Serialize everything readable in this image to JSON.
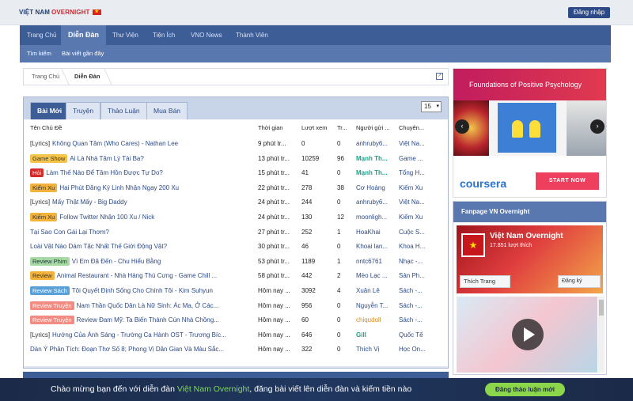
{
  "logo": {
    "part1": "VIỆT NAM",
    "part2": "OVERNIGHT"
  },
  "header": {
    "login_label": "Đăng nhập"
  },
  "nav": [
    {
      "label": "Trang Chủ"
    },
    {
      "label": "Diễn Đàn"
    },
    {
      "label": "Thư Viện"
    },
    {
      "label": "Tiện Ích"
    },
    {
      "label": "VNO News"
    },
    {
      "label": "Thành Viên"
    }
  ],
  "subnav": [
    {
      "label": "Tìm kiếm"
    },
    {
      "label": "Bài viết gần đây"
    }
  ],
  "breadcrumb": [
    {
      "label": "Trang Chủ"
    },
    {
      "label": "Diễn Đàn"
    }
  ],
  "tabs": [
    {
      "label": "Bài Mới"
    },
    {
      "label": "Truyện"
    },
    {
      "label": "Thảo Luận"
    },
    {
      "label": "Mua Bán"
    }
  ],
  "per_page": "15",
  "table": {
    "headers": {
      "title": "Tên Chủ Đề",
      "time": "Thời gian",
      "views": "Lượt xem",
      "replies": "Tr...",
      "poster": "Người gửi ...",
      "forum": "Chuyên..."
    },
    "rows": [
      {
        "prefix": "[Lyrics]",
        "prefix_style": "lyrics",
        "title": "Không Quan Tâm (Who Cares) - Nathan Lee",
        "time": "9 phút tr...",
        "views": "0",
        "replies": "0",
        "poster": "anhruby6...",
        "poster_style": "plain",
        "forum": "Việt Na..."
      },
      {
        "prefix": "Game Show",
        "prefix_style": "game",
        "title": "Ai Là Nhà Tâm Lý Tài Ba?",
        "time": "13 phút tr...",
        "views": "10259",
        "replies": "96",
        "poster": "Mạnh Th...",
        "poster_style": "green",
        "forum": "Game ..."
      },
      {
        "prefix": "Hỏi",
        "prefix_style": "hoi",
        "title": "Làm Thế Nào Để Tâm Hồn Được Tự Do?",
        "time": "15 phút tr...",
        "views": "41",
        "replies": "0",
        "poster": "Mạnh Th...",
        "poster_style": "green",
        "forum": "Tổng H..."
      },
      {
        "prefix": "Kiếm Xu",
        "prefix_style": "kiem",
        "title": "Hai Phút Đăng Ký Linh Nhận Ngay 200 Xu",
        "time": "22 phút tr...",
        "views": "278",
        "replies": "38",
        "poster": "Cơ Hoàng",
        "poster_style": "plain",
        "forum": "Kiếm Xu"
      },
      {
        "prefix": "[Lyrics]",
        "prefix_style": "lyrics",
        "title": "Mấy Thật Mấy - Big Daddy",
        "time": "24 phút tr...",
        "views": "244",
        "replies": "0",
        "poster": "anhruby6...",
        "poster_style": "plain",
        "forum": "Việt Na..."
      },
      {
        "prefix": "Kiếm Xu",
        "prefix_style": "kiem",
        "title": "Follow Twitter Nhận 100 Xu / Nick",
        "time": "24 phút tr...",
        "views": "130",
        "replies": "12",
        "poster": "moonligh...",
        "poster_style": "plain",
        "forum": "Kiếm Xu"
      },
      {
        "prefix": "",
        "prefix_style": "none",
        "title": "Tại Sao Con Gái Lại Thơm?",
        "time": "27 phút tr...",
        "views": "252",
        "replies": "1",
        "poster": "HoaKhai",
        "poster_style": "plain",
        "forum": "Cuộc S..."
      },
      {
        "prefix": "",
        "prefix_style": "none",
        "title": "Loài Vật Nào Dám Tặc Nhất Thế Giới Động Vật?",
        "time": "30 phút tr...",
        "views": "46",
        "replies": "0",
        "poster": "Khoai lan...",
        "poster_style": "plain",
        "forum": "Khoa H..."
      },
      {
        "prefix": "Review Phim",
        "prefix_style": "phim",
        "title": "Vì Em Đã Đến - Chu Hiểu Bằng",
        "time": "53 phút tr...",
        "views": "1189",
        "replies": "1",
        "poster": "nntc6761",
        "poster_style": "plain",
        "forum": "Nhạc -..."
      },
      {
        "prefix": "Review",
        "prefix_style": "review",
        "title": "Animal Restaurant - Nhà Hàng Thú Cưng - Game Chill ...",
        "time": "58 phút tr...",
        "views": "442",
        "replies": "2",
        "poster": "Mèo Lạc ...",
        "poster_style": "plain",
        "forum": "Sản Ph..."
      },
      {
        "prefix": "Review Sách",
        "prefix_style": "sach",
        "title": "Tôi Quyết Định Sống Cho Chính Tôi - Kim Suhyun",
        "time": "Hôm nay ...",
        "views": "3092",
        "replies": "4",
        "poster": "Xuân Lê",
        "poster_style": "plain",
        "forum": "Sách -..."
      },
      {
        "prefix": "Review Truyện",
        "prefix_style": "truyen",
        "title": "Nam Thần Quốc Dân Là Nữ Sinh: Ác Ma, Ở Các...",
        "time": "Hôm nay ...",
        "views": "956",
        "replies": "0",
        "poster": "Nguyễn T...",
        "poster_style": "plain",
        "forum": "Sách -..."
      },
      {
        "prefix": "Review Truyện",
        "prefix_style": "truyen",
        "title": "Review Đam Mỹ: Ta Biến Thành Cún Nhà Chồng...",
        "time": "Hôm nay ...",
        "views": "60",
        "replies": "0",
        "poster": "chiqudoll",
        "poster_style": "orange",
        "forum": "Sách -..."
      },
      {
        "prefix": "[Lyrics]",
        "prefix_style": "lyrics",
        "title": "Hướng Của Ánh Sáng - Trường Ca Hành OST - Trương Bíc...",
        "time": "Hôm nay ...",
        "views": "646",
        "replies": "0",
        "poster": "Gill",
        "poster_style": "green",
        "forum": "Quốc Tế"
      },
      {
        "prefix": "",
        "prefix_style": "none",
        "title": "Dàn Ý Phân Tích: Đoạn Thơ Số 8; Phong Vị Dân Gian Và Màu Sắc...",
        "time": "Hôm nay ...",
        "views": "322",
        "replies": "0",
        "poster": "Thích Vị",
        "poster_style": "plain",
        "forum": "Học On..."
      }
    ]
  },
  "ad": {
    "headline": "Foundations of Positive Psychology",
    "brand": "coursera",
    "cta": "START NOW",
    "prev_icon": "chevron-left-icon",
    "next_icon": "chevron-right-icon"
  },
  "fanpage": {
    "title": "Fanpage VN Overnight",
    "name": "Việt Nam Overnight",
    "likes": "17.851 lượt thích",
    "like_button": "Thích Trang",
    "subscribe_button": "Đăng ký"
  },
  "banner": {
    "text_before": "Chào mừng bạn đến với diễn đàn ",
    "highlight": "Việt Nam Overnight",
    "text_after": ", đăng bài viết lên diễn đàn và kiếm tiền nào",
    "button": "Đăng thảo luận mới"
  },
  "colors": {
    "nav": "#3d5d97",
    "subnav": "#5a78b0",
    "banner": "#1b2a47",
    "banner_accent": "#8bd64a"
  }
}
